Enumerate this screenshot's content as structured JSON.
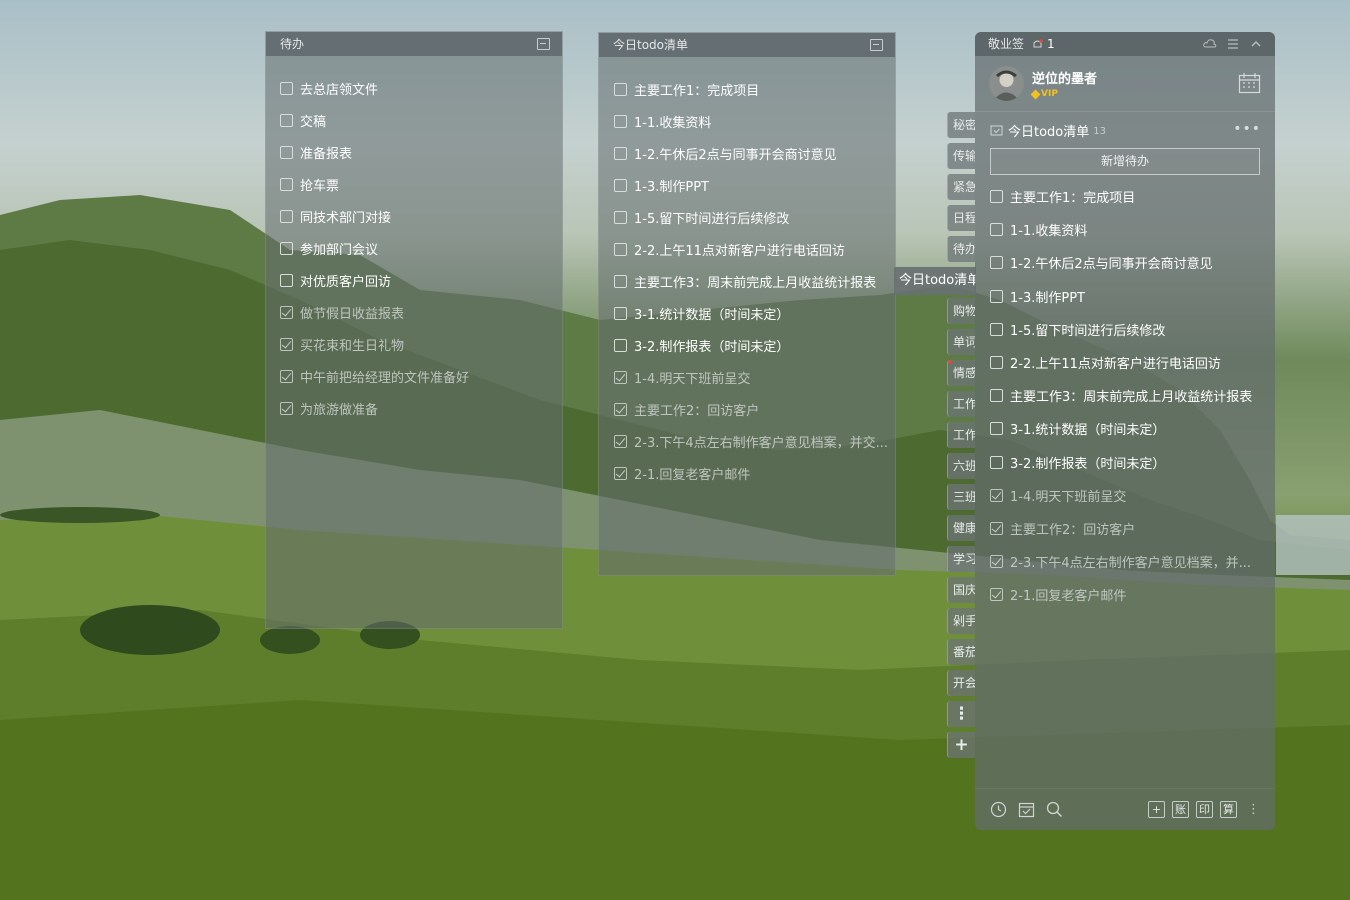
{
  "panel1": {
    "title": "待办",
    "items": [
      {
        "text": "去总店领文件",
        "done": false
      },
      {
        "text": "交稿",
        "done": false
      },
      {
        "text": "准备报表",
        "done": false
      },
      {
        "text": "抢车票",
        "done": false
      },
      {
        "text": "同技术部门对接",
        "done": false
      },
      {
        "text": "参加部门会议",
        "done": false
      },
      {
        "text": "对优质客户回访",
        "done": false
      },
      {
        "text": "做节假日收益报表",
        "done": true
      },
      {
        "text": "买花束和生日礼物",
        "done": true
      },
      {
        "text": "中午前把给经理的文件准备好",
        "done": true
      },
      {
        "text": "为旅游做准备",
        "done": true
      }
    ]
  },
  "panel2": {
    "title": "今日todo清单",
    "items": [
      {
        "text": "主要工作1：完成项目",
        "done": false
      },
      {
        "text": "1-1.收集资料",
        "done": false
      },
      {
        "text": "1-2.午休后2点与同事开会商讨意见",
        "done": false
      },
      {
        "text": "1-3.制作PPT",
        "done": false
      },
      {
        "text": "1-5.留下时间进行后续修改",
        "done": false
      },
      {
        "text": "2-2.上午11点对新客户进行电话回访",
        "done": false
      },
      {
        "text": "主要工作3：周末前完成上月收益统计报表",
        "done": false
      },
      {
        "text": "3-1.统计数据（时间未定）",
        "done": false
      },
      {
        "text": "3-2.制作报表（时间未定）",
        "done": false
      },
      {
        "text": "1-4.明天下班前呈交",
        "done": true
      },
      {
        "text": "主要工作2：回访客户",
        "done": true
      },
      {
        "text": "2-3.下午4点左右制作客户意见档案，并交...",
        "done": true
      },
      {
        "text": "2-1.回复老客户邮件",
        "done": true
      }
    ]
  },
  "tabs": [
    {
      "label": "秘密"
    },
    {
      "label": "传输"
    },
    {
      "label": "紧急"
    },
    {
      "label": "日程"
    },
    {
      "label": "待办"
    },
    {
      "label": "购物"
    },
    {
      "label": "单词"
    },
    {
      "label": "情感",
      "dot": true
    },
    {
      "label": "工作"
    },
    {
      "label": "工作"
    },
    {
      "label": "六班"
    },
    {
      "label": "三班"
    },
    {
      "label": "健康"
    },
    {
      "label": "学习"
    },
    {
      "label": "国庆"
    },
    {
      "label": "剁手"
    },
    {
      "label": "番茄"
    },
    {
      "label": "开会"
    }
  ],
  "tab_more": "⋮",
  "tab_add": "+",
  "active_tab": "今日todo清单",
  "app": {
    "title": "敬业签",
    "badge_count": "1",
    "user": {
      "name": "逆位的墨者",
      "vip": "VIP"
    },
    "list_title": "今日todo清单",
    "list_count": "13",
    "more": "•••",
    "new_button": "新增待办",
    "items": [
      {
        "text": "主要工作1：完成项目",
        "done": false
      },
      {
        "text": "1-1.收集资料",
        "done": false
      },
      {
        "text": "1-2.午休后2点与同事开会商讨意见",
        "done": false
      },
      {
        "text": "1-3.制作PPT",
        "done": false
      },
      {
        "text": "1-5.留下时间进行后续修改",
        "done": false
      },
      {
        "text": "2-2.上午11点对新客户进行电话回访",
        "done": false
      },
      {
        "text": "主要工作3：周末前完成上月收益统计报表",
        "done": false
      },
      {
        "text": "3-1.统计数据（时间未定）",
        "done": false
      },
      {
        "text": "3-2.制作报表（时间未定）",
        "done": false
      },
      {
        "text": "1-4.明天下班前呈交",
        "done": true
      },
      {
        "text": "主要工作2：回访客户",
        "done": true
      },
      {
        "text": "2-3.下午4点左右制作客户意见档案，并...",
        "done": true
      },
      {
        "text": "2-1.回复老客户邮件",
        "done": true
      }
    ],
    "footer": {
      "left_icons": [
        "clock-icon",
        "calendar-check-icon",
        "search-icon"
      ],
      "add": "+",
      "account": "账",
      "print": "印",
      "calc": "算",
      "menu": "⋮"
    }
  },
  "colors": {
    "vip": "#f3c11f",
    "badge_dot": "#e0483f"
  }
}
